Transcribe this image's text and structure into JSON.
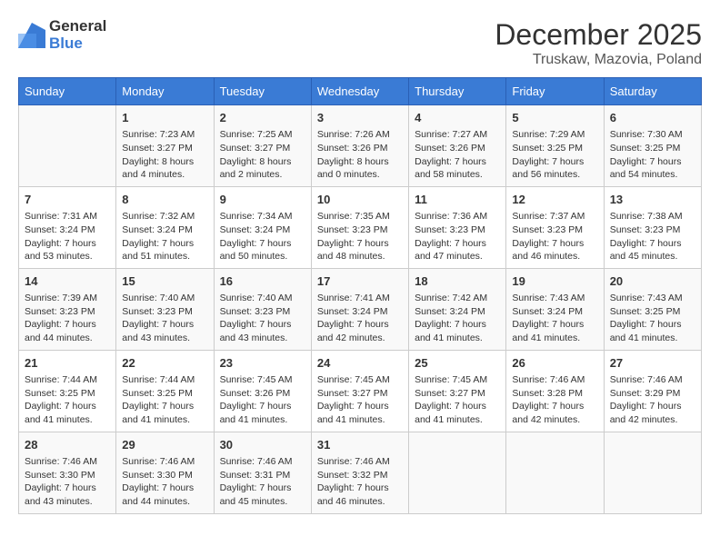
{
  "logo": {
    "general": "General",
    "blue": "Blue"
  },
  "title": "December 2025",
  "subtitle": "Truskaw, Mazovia, Poland",
  "days_header": [
    "Sunday",
    "Monday",
    "Tuesday",
    "Wednesday",
    "Thursday",
    "Friday",
    "Saturday"
  ],
  "weeks": [
    [
      {
        "day": "",
        "info": ""
      },
      {
        "day": "1",
        "info": "Sunrise: 7:23 AM\nSunset: 3:27 PM\nDaylight: 8 hours\nand 4 minutes."
      },
      {
        "day": "2",
        "info": "Sunrise: 7:25 AM\nSunset: 3:27 PM\nDaylight: 8 hours\nand 2 minutes."
      },
      {
        "day": "3",
        "info": "Sunrise: 7:26 AM\nSunset: 3:26 PM\nDaylight: 8 hours\nand 0 minutes."
      },
      {
        "day": "4",
        "info": "Sunrise: 7:27 AM\nSunset: 3:26 PM\nDaylight: 7 hours\nand 58 minutes."
      },
      {
        "day": "5",
        "info": "Sunrise: 7:29 AM\nSunset: 3:25 PM\nDaylight: 7 hours\nand 56 minutes."
      },
      {
        "day": "6",
        "info": "Sunrise: 7:30 AM\nSunset: 3:25 PM\nDaylight: 7 hours\nand 54 minutes."
      }
    ],
    [
      {
        "day": "7",
        "info": "Sunrise: 7:31 AM\nSunset: 3:24 PM\nDaylight: 7 hours\nand 53 minutes."
      },
      {
        "day": "8",
        "info": "Sunrise: 7:32 AM\nSunset: 3:24 PM\nDaylight: 7 hours\nand 51 minutes."
      },
      {
        "day": "9",
        "info": "Sunrise: 7:34 AM\nSunset: 3:24 PM\nDaylight: 7 hours\nand 50 minutes."
      },
      {
        "day": "10",
        "info": "Sunrise: 7:35 AM\nSunset: 3:23 PM\nDaylight: 7 hours\nand 48 minutes."
      },
      {
        "day": "11",
        "info": "Sunrise: 7:36 AM\nSunset: 3:23 PM\nDaylight: 7 hours\nand 47 minutes."
      },
      {
        "day": "12",
        "info": "Sunrise: 7:37 AM\nSunset: 3:23 PM\nDaylight: 7 hours\nand 46 minutes."
      },
      {
        "day": "13",
        "info": "Sunrise: 7:38 AM\nSunset: 3:23 PM\nDaylight: 7 hours\nand 45 minutes."
      }
    ],
    [
      {
        "day": "14",
        "info": "Sunrise: 7:39 AM\nSunset: 3:23 PM\nDaylight: 7 hours\nand 44 minutes."
      },
      {
        "day": "15",
        "info": "Sunrise: 7:40 AM\nSunset: 3:23 PM\nDaylight: 7 hours\nand 43 minutes."
      },
      {
        "day": "16",
        "info": "Sunrise: 7:40 AM\nSunset: 3:23 PM\nDaylight: 7 hours\nand 43 minutes."
      },
      {
        "day": "17",
        "info": "Sunrise: 7:41 AM\nSunset: 3:24 PM\nDaylight: 7 hours\nand 42 minutes."
      },
      {
        "day": "18",
        "info": "Sunrise: 7:42 AM\nSunset: 3:24 PM\nDaylight: 7 hours\nand 41 minutes."
      },
      {
        "day": "19",
        "info": "Sunrise: 7:43 AM\nSunset: 3:24 PM\nDaylight: 7 hours\nand 41 minutes."
      },
      {
        "day": "20",
        "info": "Sunrise: 7:43 AM\nSunset: 3:25 PM\nDaylight: 7 hours\nand 41 minutes."
      }
    ],
    [
      {
        "day": "21",
        "info": "Sunrise: 7:44 AM\nSunset: 3:25 PM\nDaylight: 7 hours\nand 41 minutes."
      },
      {
        "day": "22",
        "info": "Sunrise: 7:44 AM\nSunset: 3:25 PM\nDaylight: 7 hours\nand 41 minutes."
      },
      {
        "day": "23",
        "info": "Sunrise: 7:45 AM\nSunset: 3:26 PM\nDaylight: 7 hours\nand 41 minutes."
      },
      {
        "day": "24",
        "info": "Sunrise: 7:45 AM\nSunset: 3:27 PM\nDaylight: 7 hours\nand 41 minutes."
      },
      {
        "day": "25",
        "info": "Sunrise: 7:45 AM\nSunset: 3:27 PM\nDaylight: 7 hours\nand 41 minutes."
      },
      {
        "day": "26",
        "info": "Sunrise: 7:46 AM\nSunset: 3:28 PM\nDaylight: 7 hours\nand 42 minutes."
      },
      {
        "day": "27",
        "info": "Sunrise: 7:46 AM\nSunset: 3:29 PM\nDaylight: 7 hours\nand 42 minutes."
      }
    ],
    [
      {
        "day": "28",
        "info": "Sunrise: 7:46 AM\nSunset: 3:30 PM\nDaylight: 7 hours\nand 43 minutes."
      },
      {
        "day": "29",
        "info": "Sunrise: 7:46 AM\nSunset: 3:30 PM\nDaylight: 7 hours\nand 44 minutes."
      },
      {
        "day": "30",
        "info": "Sunrise: 7:46 AM\nSunset: 3:31 PM\nDaylight: 7 hours\nand 45 minutes."
      },
      {
        "day": "31",
        "info": "Sunrise: 7:46 AM\nSunset: 3:32 PM\nDaylight: 7 hours\nand 46 minutes."
      },
      {
        "day": "",
        "info": ""
      },
      {
        "day": "",
        "info": ""
      },
      {
        "day": "",
        "info": ""
      }
    ]
  ]
}
